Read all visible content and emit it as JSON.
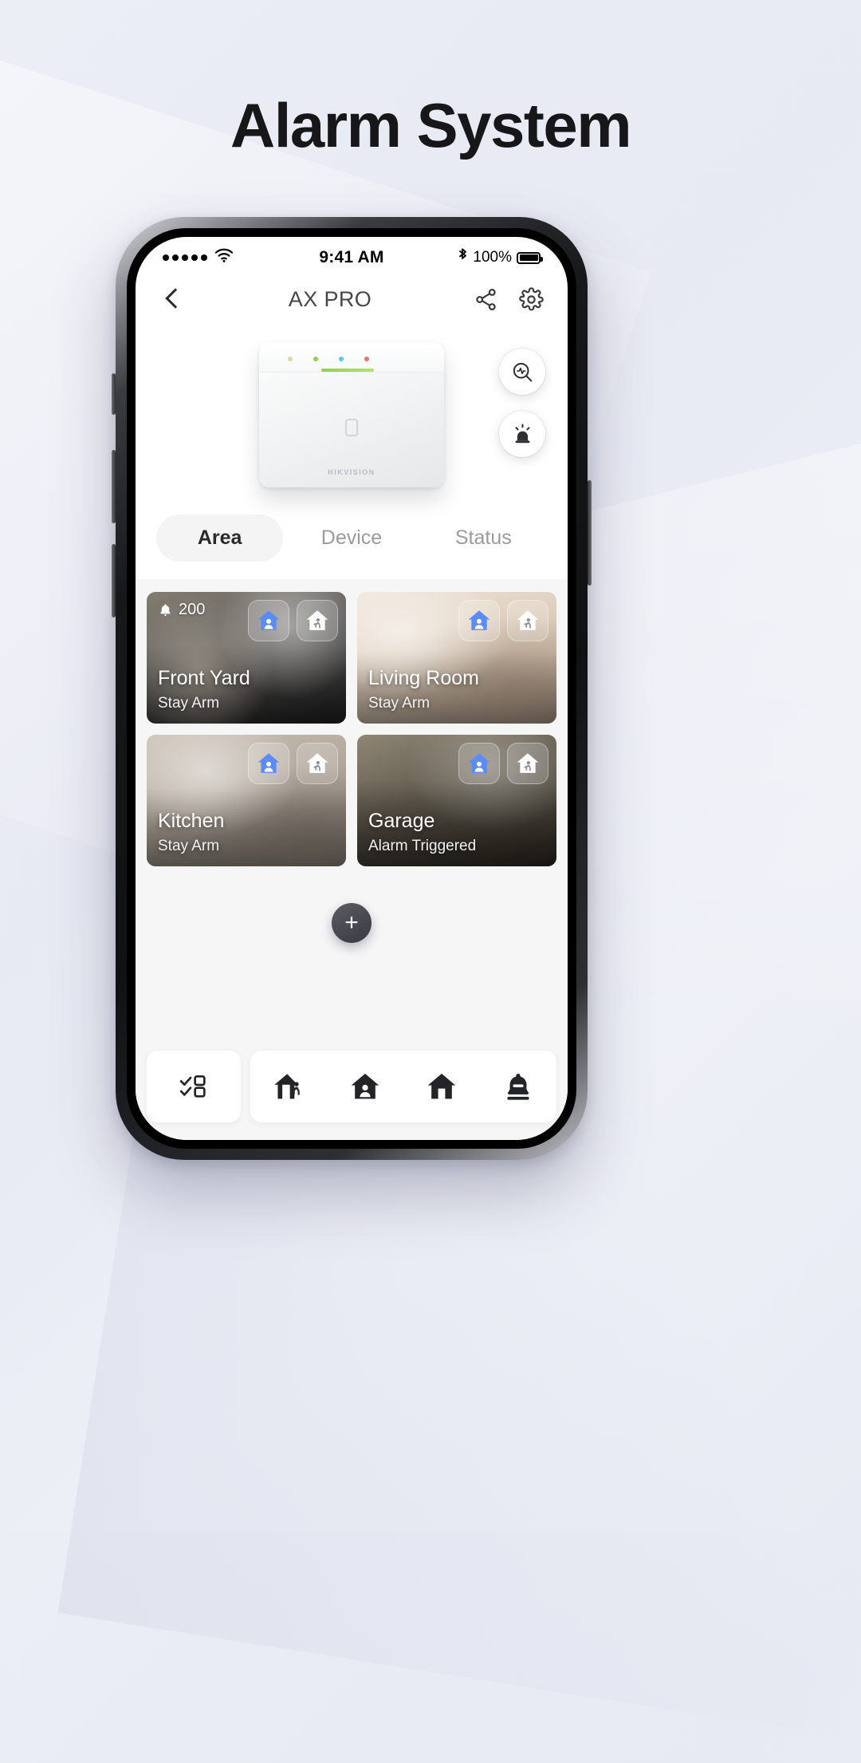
{
  "page": {
    "title": "Alarm System"
  },
  "statusbar": {
    "signal_dots": 5,
    "wifi_icon": "wifi-icon",
    "time": "9:41 AM",
    "bluetooth_icon": "bluetooth-icon",
    "battery_percent": "100%",
    "battery_icon": "battery-full-icon"
  },
  "appbar": {
    "back_icon": "chevron-left-icon",
    "title": "AX PRO",
    "share_icon": "share-icon",
    "settings_icon": "gear-icon"
  },
  "hero": {
    "hub_brand": "HIKVISION",
    "led_colors": [
      "#d9d99a",
      "#8fd24a",
      "#5bc8e8",
      "#e8736a"
    ],
    "status_bar_color": "#8fd24a",
    "actions": [
      {
        "name": "diagnostics-button",
        "icon": "magnifier-pulse-icon"
      },
      {
        "name": "siren-button",
        "icon": "siren-icon"
      }
    ]
  },
  "tabs": [
    {
      "label": "Area",
      "active": true
    },
    {
      "label": "Device",
      "active": false
    },
    {
      "label": "Status",
      "active": false
    }
  ],
  "areas": [
    {
      "name": "Front Yard",
      "status": "Stay Arm",
      "alarm_count": "200",
      "bell_icon": "bell-icon",
      "stay_arm_icon": "house-person-icon",
      "away_arm_icon": "house-walking-icon",
      "theme": "bg-frontyard",
      "has_badge": true
    },
    {
      "name": "Living Room",
      "status": "Stay Arm",
      "alarm_count": "",
      "bell_icon": "bell-icon",
      "stay_arm_icon": "house-person-icon",
      "away_arm_icon": "house-walking-icon",
      "theme": "bg-living",
      "has_badge": false
    },
    {
      "name": "Kitchen",
      "status": "Stay Arm",
      "alarm_count": "",
      "bell_icon": "bell-icon",
      "stay_arm_icon": "house-person-icon",
      "away_arm_icon": "house-walking-icon",
      "theme": "bg-kitchen",
      "has_badge": false
    },
    {
      "name": "Garage",
      "status": "Alarm Triggered",
      "alarm_count": "",
      "bell_icon": "bell-icon",
      "stay_arm_icon": "house-person-icon",
      "away_arm_icon": "house-walking-icon",
      "theme": "bg-garage",
      "has_badge": false
    }
  ],
  "fab": {
    "label": "+",
    "icon": "plus-icon"
  },
  "bottom_nav": {
    "select_all": {
      "name": "select-areas-button",
      "icon": "checklist-icon"
    },
    "items": [
      {
        "name": "away-arm-button",
        "icon": "house-walking-icon"
      },
      {
        "name": "stay-arm-button",
        "icon": "house-person-icon"
      },
      {
        "name": "disarm-button",
        "icon": "house-icon"
      },
      {
        "name": "clear-alarm-button",
        "icon": "bell-mute-icon"
      }
    ]
  },
  "colors": {
    "accent_blue": "#5b8cf5",
    "active_tab_bg": "#f4f4f5",
    "page_bg": "#ecedf5"
  }
}
